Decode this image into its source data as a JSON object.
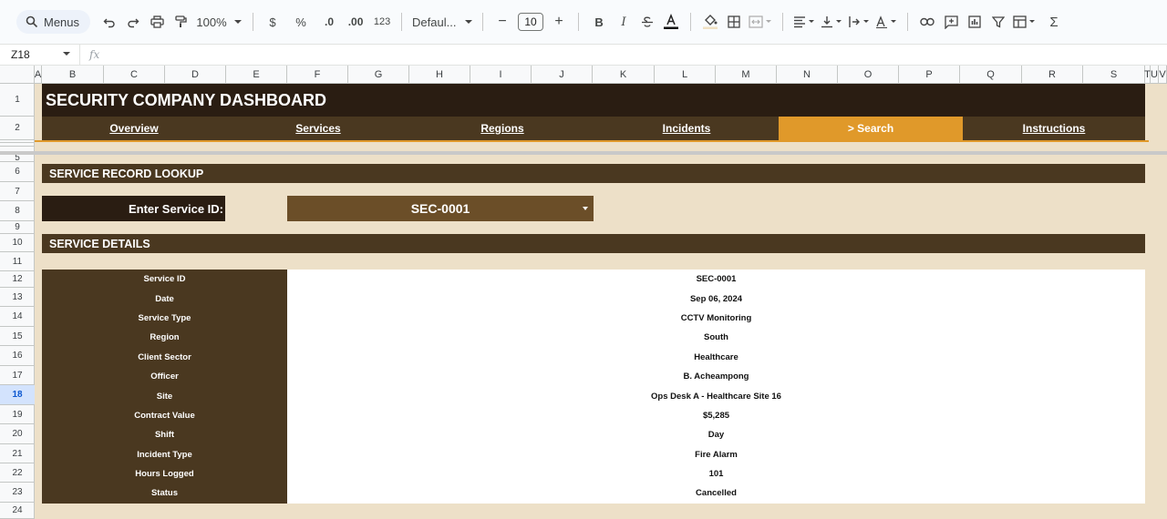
{
  "toolbar": {
    "menus_label": "Menus",
    "zoom": "100%",
    "currency": "$",
    "percent": "%",
    "decrease_decimal": ".0",
    "increase_decimal": ".00",
    "number_format": "123",
    "font": "Defaul...",
    "font_size": "10",
    "bold": "B",
    "italic": "I",
    "sum": "Σ"
  },
  "formula_bar": {
    "cell_ref": "Z18",
    "fx": "fx"
  },
  "columns": [
    "A",
    "B",
    "C",
    "D",
    "E",
    "F",
    "G",
    "H",
    "I",
    "J",
    "K",
    "L",
    "M",
    "N",
    "O",
    "P",
    "Q",
    "R",
    "S",
    "T",
    "U",
    "V"
  ],
  "rows": [
    "1",
    "2",
    "3",
    "4",
    "5",
    "6",
    "7",
    "8",
    "9",
    "10",
    "11",
    "12",
    "13",
    "14",
    "15",
    "16",
    "17",
    "18",
    "19",
    "20",
    "21",
    "22",
    "23",
    "24"
  ],
  "selected_row": "18",
  "dashboard": {
    "title": "SECURITY COMPANY DASHBOARD",
    "nav": [
      {
        "label": "Overview",
        "active": false
      },
      {
        "label": "Services",
        "active": false
      },
      {
        "label": "Regions",
        "active": false
      },
      {
        "label": "Incidents",
        "active": false
      },
      {
        "label": "> Search",
        "active": true
      },
      {
        "label": "Instructions",
        "active": false
      }
    ],
    "colors": {
      "dark": "#2a1d12",
      "brown": "#4a3820",
      "accent": "#e0992a",
      "background": "#ede0c8"
    }
  },
  "lookup": {
    "section_title": "SERVICE RECORD LOOKUP",
    "label": "Enter Service ID:",
    "selected_id": "SEC-0001"
  },
  "details": {
    "section_title": "SERVICE DETAILS",
    "rows": [
      {
        "label": "Service ID",
        "value": "SEC-0001"
      },
      {
        "label": "Date",
        "value": "Sep 06, 2024"
      },
      {
        "label": "Service Type",
        "value": "CCTV Monitoring"
      },
      {
        "label": "Region",
        "value": "South"
      },
      {
        "label": "Client Sector",
        "value": "Healthcare"
      },
      {
        "label": "Officer",
        "value": "B. Acheampong"
      },
      {
        "label": "Site",
        "value": "Ops Desk A - Healthcare Site 16"
      },
      {
        "label": "Contract Value",
        "value": "$5,285"
      },
      {
        "label": "Shift",
        "value": "Day"
      },
      {
        "label": "Incident Type",
        "value": "Fire Alarm"
      },
      {
        "label": "Hours Logged",
        "value": "101"
      },
      {
        "label": "Status",
        "value": "Cancelled"
      }
    ]
  }
}
